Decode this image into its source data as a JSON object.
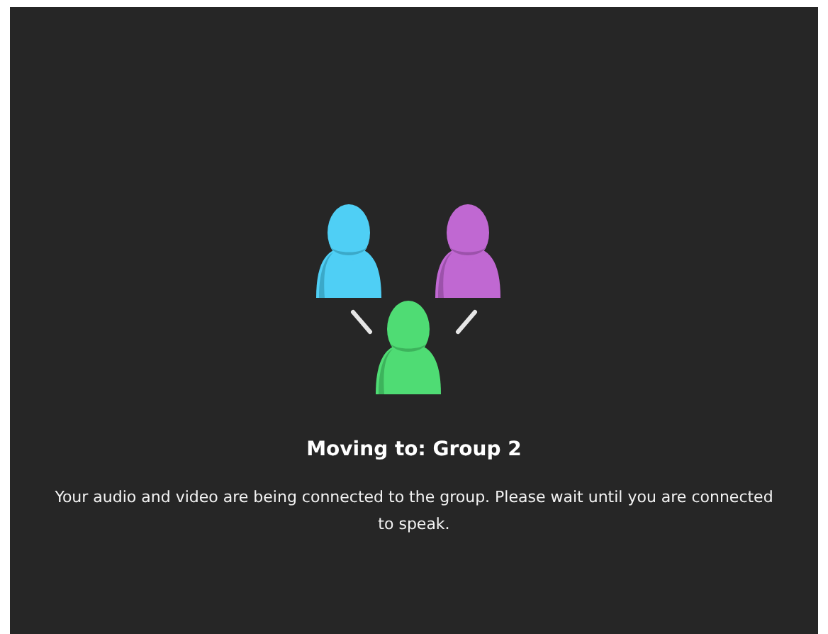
{
  "title": "Moving to: Group 2",
  "message": "Your audio and video are being connected to the group. Please wait until you are connected to speak."
}
